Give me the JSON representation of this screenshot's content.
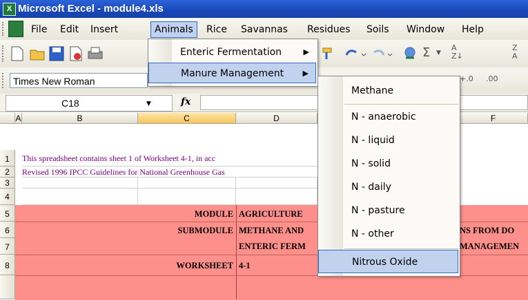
{
  "window": {
    "title": "Microsoft Excel - module4.xls",
    "app_icon": "excel-icon"
  },
  "menubar": {
    "items": [
      {
        "label": "File",
        "u": "F"
      },
      {
        "label": "Edit",
        "u": "E"
      },
      {
        "label": "Insert",
        "u": "I"
      },
      {
        "label": "Animals",
        "u": "A"
      },
      {
        "label": "Rice",
        "u": "R"
      },
      {
        "label": "Savannas",
        "u": "S"
      },
      {
        "label": "Residues",
        "u": "d"
      },
      {
        "label": "Soils",
        "u": "i"
      },
      {
        "label": "Window",
        "u": "W"
      },
      {
        "label": "Help",
        "u": "H"
      }
    ]
  },
  "formatting": {
    "font_name": "Times New Roman"
  },
  "formula_bar": {
    "name_box": "C18",
    "fx": "fx"
  },
  "columns": [
    "A",
    "B",
    "C",
    "D",
    "E",
    "F"
  ],
  "rows": [
    "1",
    "2",
    "3",
    "4",
    "5",
    "6",
    "7",
    "8"
  ],
  "cells": {
    "B1": "This spreadsheet contains sheet 1 of Worksheet 4-1, in acc",
    "B2": "Revised 1996 IPCC Guidelines for National Greenhouse Gas",
    "C5": "MODULE",
    "D5": "AGRICULTURE",
    "C6": "SUBMODULE",
    "D6": "METHANE AND",
    "D7": "ENTERIC FERM",
    "F6": "NS FROM DO",
    "F7": "MANAGEMEN",
    "C8": "WORKSHEET",
    "D8": "4-1"
  },
  "animals_menu": {
    "items": [
      {
        "label": "Enteric Fermentation",
        "u": "F",
        "has_submenu": true
      },
      {
        "label": "Manure Management",
        "u": "M",
        "has_submenu": true
      }
    ]
  },
  "manure_submenu": {
    "items": [
      {
        "label": "Methane"
      },
      {
        "label": "N - anaerobic"
      },
      {
        "label": "N - liquid"
      },
      {
        "label": "N - solid"
      },
      {
        "label": "N - daily"
      },
      {
        "label": "N - pasture"
      },
      {
        "label": "N - other"
      },
      {
        "label": "Nitrous Oxide"
      }
    ]
  },
  "colors": {
    "title_bar": "#1a47b8",
    "highlight": "#c1d2ee",
    "header_red": "#ff8f8a",
    "info_text": "#800080"
  }
}
